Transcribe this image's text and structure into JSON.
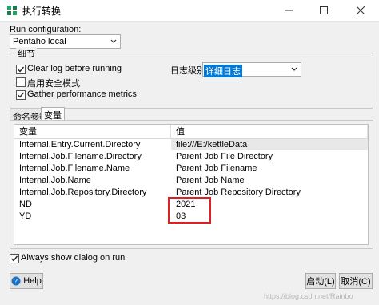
{
  "window": {
    "title": "执行转换",
    "controls": [
      "minimize-icon",
      "maximize-icon",
      "close-icon"
    ]
  },
  "run_configuration": {
    "label": "Run configuration:",
    "selected": "Pentaho local"
  },
  "details_group": {
    "title": "细节",
    "clear_log": {
      "label": "Clear log before running",
      "checked": true
    },
    "safe_mode": {
      "label": "启用安全模式",
      "checked": false
    },
    "gather_metrics": {
      "label": "Gather performance metrics",
      "checked": true
    },
    "log_level": {
      "label": "日志级别",
      "selected": "详细日志"
    }
  },
  "tabs": [
    {
      "label": "命名参数",
      "active": false
    },
    {
      "label": "变量",
      "active": true
    }
  ],
  "variables_table": {
    "columns": [
      "变量",
      "值"
    ],
    "rows": [
      {
        "name": "Internal.Entry.Current.Directory",
        "value": "file:///E:/kettleData",
        "highlighted": true
      },
      {
        "name": "Internal.Job.Filename.Directory",
        "value": "Parent Job File Directory",
        "highlighted": false
      },
      {
        "name": "Internal.Job.Filename.Name",
        "value": "Parent Job Filename",
        "highlighted": false
      },
      {
        "name": "Internal.Job.Name",
        "value": "Parent Job Name",
        "highlighted": false
      },
      {
        "name": "Internal.Job.Repository.Directory",
        "value": "Parent Job Repository Directory",
        "highlighted": false
      },
      {
        "name": "ND",
        "value": "2021",
        "highlighted": false
      },
      {
        "name": "YD",
        "value": "03",
        "highlighted": false
      }
    ]
  },
  "always_show": {
    "label": "Always show dialog on run",
    "checked": true
  },
  "buttons": {
    "help": "Help",
    "start": "启动(L)",
    "cancel": "取消(C)"
  },
  "watermark": "https://blog.csdn.net/Rainbo",
  "colors": {
    "selection": "#0078d7",
    "highlight_row": "#e8e8e8",
    "annotation_box": "#e02020",
    "app_icon": "#21a366"
  }
}
